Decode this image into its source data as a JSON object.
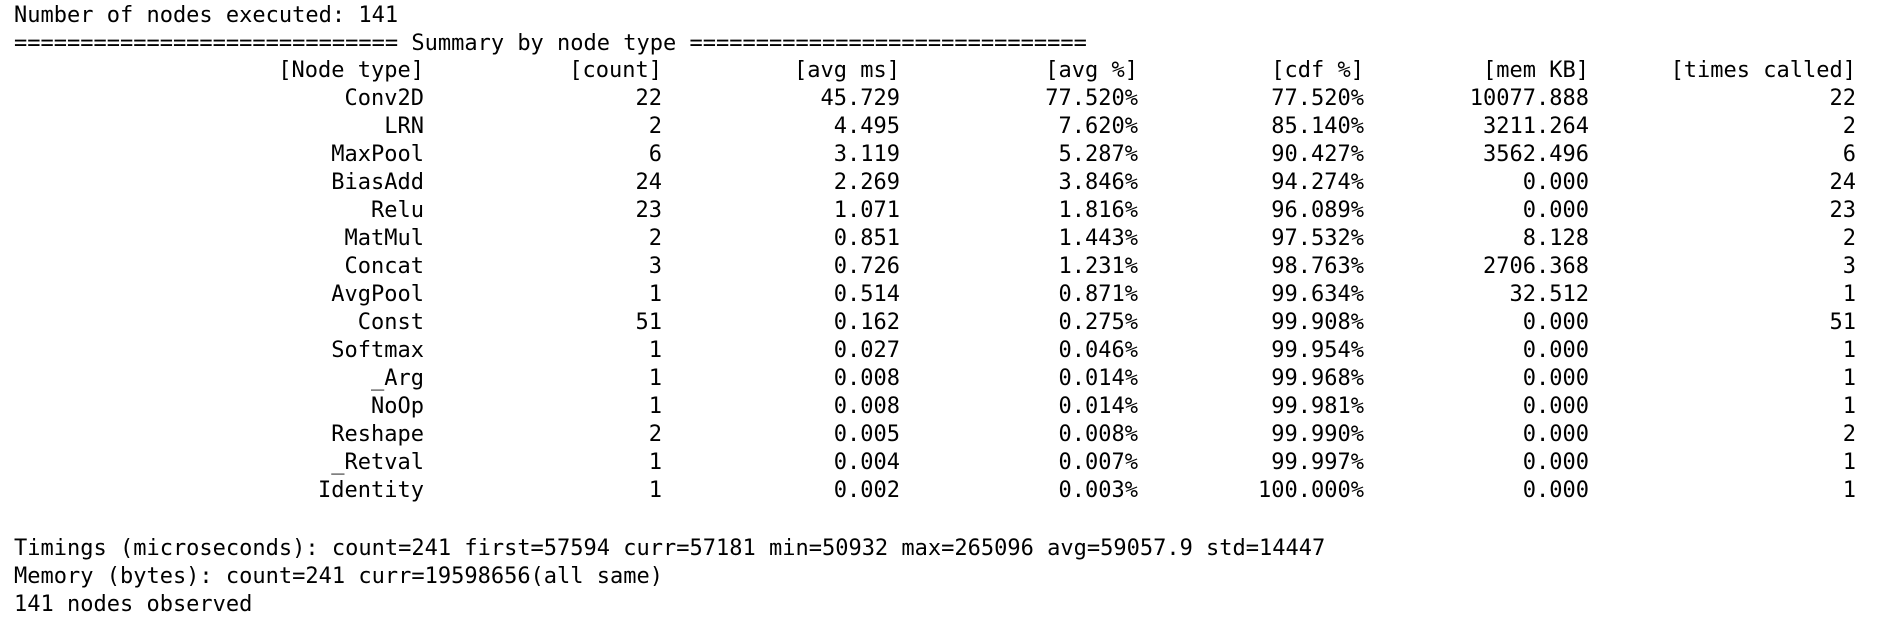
{
  "header_line": "Number of nodes executed: 141",
  "separator_line": "============================= Summary by node type ==============================",
  "columns": [
    "[Node type]",
    "[count]",
    "[avg ms]",
    "[avg %]",
    "[cdf %]",
    "[mem KB]",
    "[times called]"
  ],
  "rows": [
    [
      "Conv2D",
      "22",
      "45.729",
      "77.520%",
      "77.520%",
      "10077.888",
      "22"
    ],
    [
      "LRN",
      "2",
      "4.495",
      "7.620%",
      "85.140%",
      "3211.264",
      "2"
    ],
    [
      "MaxPool",
      "6",
      "3.119",
      "5.287%",
      "90.427%",
      "3562.496",
      "6"
    ],
    [
      "BiasAdd",
      "24",
      "2.269",
      "3.846%",
      "94.274%",
      "0.000",
      "24"
    ],
    [
      "Relu",
      "23",
      "1.071",
      "1.816%",
      "96.089%",
      "0.000",
      "23"
    ],
    [
      "MatMul",
      "2",
      "0.851",
      "1.443%",
      "97.532%",
      "8.128",
      "2"
    ],
    [
      "Concat",
      "3",
      "0.726",
      "1.231%",
      "98.763%",
      "2706.368",
      "3"
    ],
    [
      "AvgPool",
      "1",
      "0.514",
      "0.871%",
      "99.634%",
      "32.512",
      "1"
    ],
    [
      "Const",
      "51",
      "0.162",
      "0.275%",
      "99.908%",
      "0.000",
      "51"
    ],
    [
      "Softmax",
      "1",
      "0.027",
      "0.046%",
      "99.954%",
      "0.000",
      "1"
    ],
    [
      "_Arg",
      "1",
      "0.008",
      "0.014%",
      "99.968%",
      "0.000",
      "1"
    ],
    [
      "NoOp",
      "1",
      "0.008",
      "0.014%",
      "99.981%",
      "0.000",
      "1"
    ],
    [
      "Reshape",
      "2",
      "0.005",
      "0.008%",
      "99.990%",
      "0.000",
      "2"
    ],
    [
      "_Retval",
      "1",
      "0.004",
      "0.007%",
      "99.997%",
      "0.000",
      "1"
    ],
    [
      "Identity",
      "1",
      "0.002",
      "0.003%",
      "100.000%",
      "0.000",
      "1"
    ]
  ],
  "footer": {
    "timings": "Timings (microseconds): count=241 first=57594 curr=57181 min=50932 max=265096 avg=59057.9 std=14447",
    "memory": "Memory (bytes): count=241 curr=19598656(all same)",
    "observed": "141 nodes observed"
  }
}
